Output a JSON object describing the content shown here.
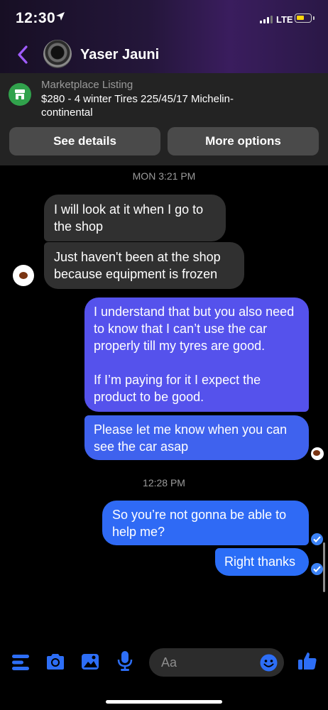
{
  "status_bar": {
    "time": "12:30",
    "network": "LTE"
  },
  "header": {
    "contact_name": "Yaser Jauni",
    "icons": [
      "back-chevron-icon",
      "location-arrow-icon",
      "signal-icon",
      "battery-icon"
    ]
  },
  "listing": {
    "label": "Marketplace Listing",
    "title": "$280 - 4 winter Tires 225/45/17 Michelin-continental",
    "see_details": "See details",
    "more_options": "More options"
  },
  "conversation": {
    "timestamp_1": "MON 3:21 PM",
    "received": [
      "I will look at it when I go to the shop",
      "Just haven't been at the shop because equipment is frozen"
    ],
    "sent_block": {
      "line1": "I understand that but you also need to know that I can’t use the car properly till my tyres are good.",
      "line2": "If I’m paying for it I expect the product to be good."
    },
    "sent_2": "Please let me know when you can see the car asap",
    "timestamp_2": "12:28 PM",
    "sent_3": "So you’re not gonna be able to help me?",
    "sent_4": "Right thanks"
  },
  "composer": {
    "placeholder": "Aa",
    "icons": [
      "menu-icon",
      "camera-icon",
      "gallery-icon",
      "microphone-icon",
      "emoji-icon",
      "thumbs-up-icon"
    ]
  },
  "colors": {
    "accent": "#2d6ef6",
    "sent_bubble": "#5552ec",
    "received_bubble": "#303030",
    "marketplace_green": "#31a24c"
  }
}
